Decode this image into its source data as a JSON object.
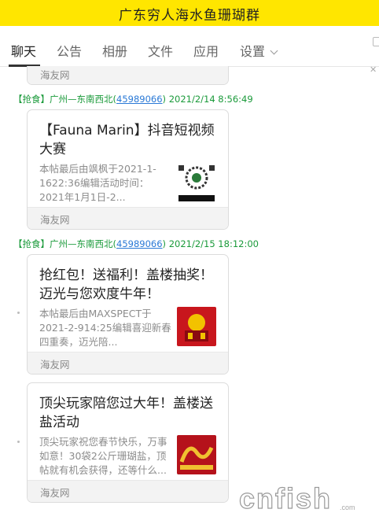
{
  "header": {
    "title": "广东穷人海水鱼珊瑚群"
  },
  "tabs": [
    {
      "label": "聊天"
    },
    {
      "label": "公告"
    },
    {
      "label": "相册"
    },
    {
      "label": "文件"
    },
    {
      "label": "应用"
    },
    {
      "label": "设置"
    }
  ],
  "close_icon": "✕",
  "messages": [
    {
      "card": {
        "footer": "海友网"
      }
    },
    {
      "meta": {
        "prefix": "【抢食】广州—东南西北(",
        "qq": "45989066",
        "suffix": ") 2021/2/14 8:56:49"
      },
      "card": {
        "title": "【Fauna Marin】抖音短视频大赛",
        "desc": "本帖最后由飒枫于2021-1-1622:36编辑活动时间：2021年1月1日-2...",
        "footer": "海友网",
        "thumb_colors": [
          "#ffffff",
          "#111111"
        ]
      }
    },
    {
      "meta": {
        "prefix": "【抢食】广州—东南西北(",
        "qq": "45989066",
        "suffix": ") 2021/2/15 18:12:00"
      },
      "card": {
        "title": "抢红包！送福利！盖楼抽奖！迈光与您欢度牛年！",
        "desc": "本帖最后由MAXSPECT于2021-2-914:25编辑喜迎新春四重奏，迈光陪...",
        "footer": "海友网",
        "thumb_colors": [
          "#c8161d",
          "#f2c200"
        ]
      }
    },
    {
      "card": {
        "title": "顶尖玩家陪您过大年！盖楼送盐活动",
        "desc": "顶尖玩家祝您春节快乐，万事如意！30袋2公斤珊瑚盐，顶帖就有机会获得，还等什么...",
        "footer": "海友网",
        "thumb_colors": [
          "#b5121b",
          "#f0c030"
        ]
      }
    }
  ],
  "watermark": {
    "text": "cnfish",
    "color": "#9a9a9a"
  },
  "colors": {
    "header_bg": "#ffe600",
    "meta_green": "#1a9a3a",
    "link_blue": "#2a79d6"
  }
}
